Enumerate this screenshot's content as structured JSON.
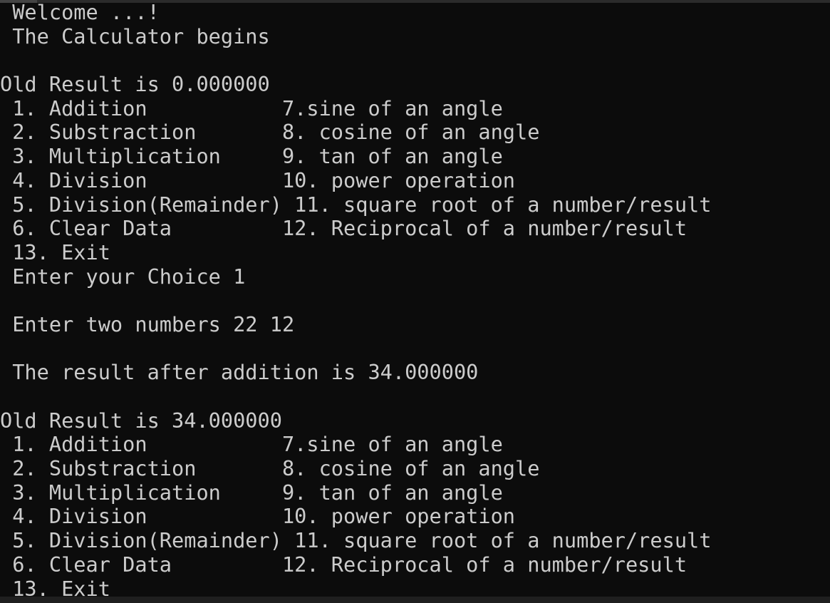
{
  "console": {
    "lines": [
      " Welcome ...!",
      " The Calculator begins",
      "",
      "Old Result is 0.000000",
      " 1. Addition           7.sine of an angle",
      " 2. Substraction       8. cosine of an angle",
      " 3. Multiplication     9. tan of an angle",
      " 4. Division           10. power operation",
      " 5. Division(Remainder) 11. square root of a number/result",
      " 6. Clear Data         12. Reciprocal of a number/result",
      " 13. Exit",
      " Enter your Choice 1",
      "",
      " Enter two numbers 22 12",
      "",
      " The result after addition is 34.000000",
      "",
      "Old Result is 34.000000",
      " 1. Addition           7.sine of an angle",
      " 2. Substraction       8. cosine of an angle",
      " 3. Multiplication     9. tan of an angle",
      " 4. Division           10. power operation",
      " 5. Division(Remainder) 11. square root of a number/result",
      " 6. Clear Data         12. Reciprocal of a number/result",
      " 13. Exit"
    ]
  }
}
